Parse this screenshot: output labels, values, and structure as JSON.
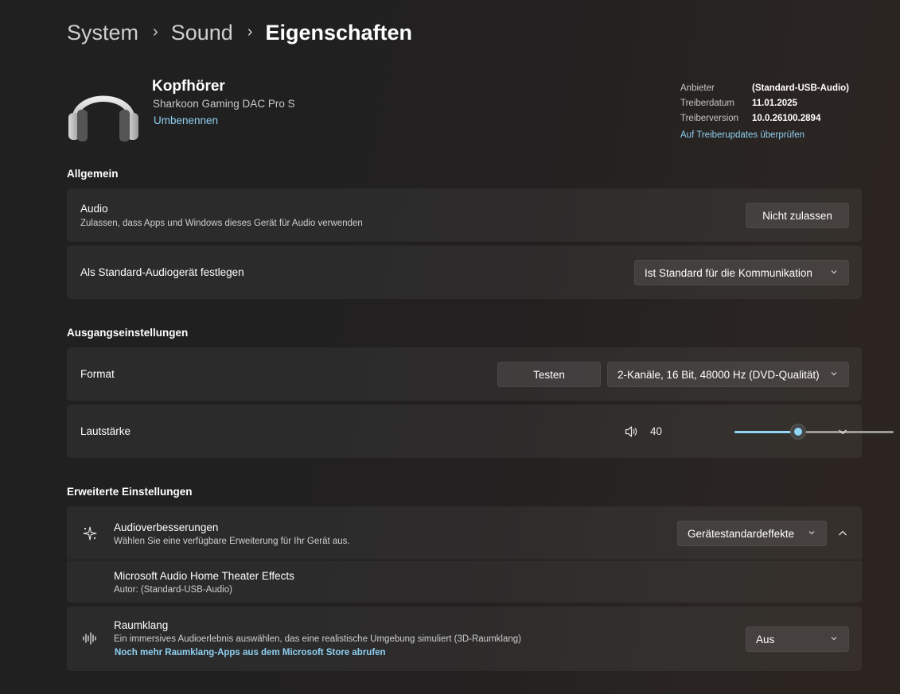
{
  "breadcrumb": {
    "items": [
      "System",
      "Sound"
    ],
    "separator": "›",
    "current": "Eigenschaften"
  },
  "device": {
    "name": "Kopfhörer",
    "model": "Sharkoon Gaming DAC Pro S",
    "rename_link": "Umbenennen",
    "icon": "headphones-icon"
  },
  "driver_info": {
    "rows": [
      {
        "label": "Anbieter",
        "value": "(Standard-USB-Audio)"
      },
      {
        "label": "Treiberdatum",
        "value": "11.01.2025"
      },
      {
        "label": "Treiberversion",
        "value": "10.0.26100.2894"
      }
    ],
    "update_link": "Auf Treiberupdates überprüfen"
  },
  "general": {
    "heading": "Allgemein",
    "audio": {
      "title": "Audio",
      "subtitle": "Zulassen, dass Apps und Windows dieses Gerät für Audio verwenden",
      "button": "Nicht zulassen"
    },
    "default": {
      "title": "Als Standard-Audiogerät festlegen",
      "selected": "Ist Standard für die Kommunikation"
    }
  },
  "output": {
    "heading": "Ausgangseinstellungen",
    "format": {
      "title": "Format",
      "test_button": "Testen",
      "selected": "2-Kanäle, 16 Bit, 48000 Hz (DVD-Qualität)"
    },
    "volume": {
      "title": "Lautstärke",
      "value": "40",
      "level": 0.4,
      "icon": "speaker-icon"
    }
  },
  "advanced": {
    "heading": "Erweiterte Einstellungen",
    "enhancements": {
      "title": "Audioverbesserungen",
      "subtitle": "Wählen Sie eine verfügbare Erweiterung für Ihr Gerät aus.",
      "selected": "Gerätestandardeffekte",
      "icon": "sparkle-icon"
    },
    "effect_item": {
      "title": "Microsoft Audio Home Theater Effects",
      "subtitle": "Autor: (Standard-USB-Audio)"
    },
    "spatial": {
      "title": "Raumklang",
      "subtitle": "Ein immersives Audioerlebnis auswählen, das eine realistische Umgebung simuliert (3D-Raumklang)",
      "link": "Noch mehr Raumklang-Apps aus dem Microsoft Store abrufen",
      "selected": "Aus",
      "icon": "soundwave-icon"
    }
  },
  "colors": {
    "accent": "#8fd6f7",
    "link": "#8ed0f2"
  }
}
